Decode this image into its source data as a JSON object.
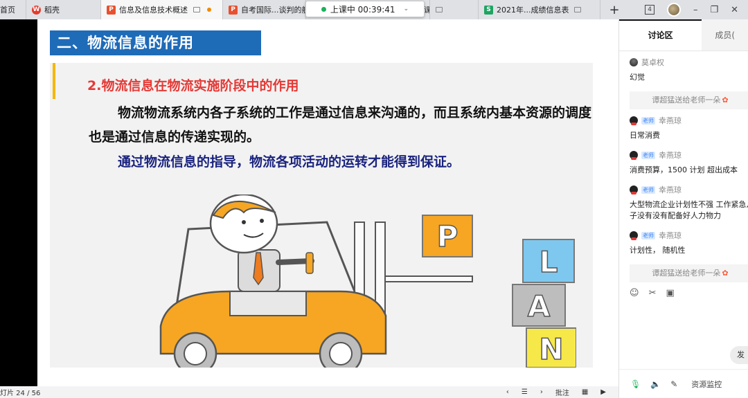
{
  "tabs": [
    {
      "label": "首页",
      "icon": "",
      "active": false
    },
    {
      "label": "稻壳",
      "icon": "wps-logo-icon",
      "active": false
    },
    {
      "label": "信息及信息技术概述",
      "icon": "presentation-file-icon",
      "active": true
    },
    {
      "label": "自考国际...谈判的舰",
      "icon": "presentation-file-icon",
      "active": false
    },
    {
      "label": "课件",
      "icon": "",
      "active": false
    },
    {
      "label": "2021年...成绩信息表",
      "icon": "spreadsheet-file-icon",
      "active": false
    }
  ],
  "tab_plus": "+",
  "window": {
    "badge": "4",
    "minimize": "–",
    "restore": "❐",
    "close": "✕"
  },
  "timer": {
    "text": "上课中 00:39:41",
    "status_color": "#19b35a"
  },
  "slide": {
    "title": "二、物流信息的作用",
    "subheading": "2.物流信息在物流实施阶段中的作用",
    "paragraph": "物流物流系统内各子系统的工作是通过信息来沟通的，而且系统内基本资源的调度也是通过信息的传递实现的。",
    "paragraph2": "通过物流信息的指导，物流各项活动的运转才能得到保证。",
    "plan_letters": [
      "P",
      "L",
      "A",
      "N"
    ],
    "colors": {
      "title_bg": "#1e6bb8",
      "subheading": "#e53935",
      "paragraph2": "#1a237e",
      "accent": "#f5b800"
    }
  },
  "panel": {
    "tabs": [
      "讨论区",
      "成员("
    ],
    "messages": [
      {
        "type": "msg",
        "name": "莫卓权",
        "teacher": false,
        "avatar": "photo",
        "text": "幻觉"
      },
      {
        "type": "gift",
        "text": "谭超猛送给老师一朵"
      },
      {
        "type": "msg",
        "name": "幸燕琼",
        "teacher": true,
        "avatar": "qq",
        "text": "日常消费"
      },
      {
        "type": "msg",
        "name": "幸燕琼",
        "teacher": true,
        "avatar": "qq",
        "text": "消费预算，1500  计划   超出成本"
      },
      {
        "type": "msg",
        "name": "幸燕琼",
        "teacher": true,
        "avatar": "qq",
        "text": "大型物流企业计划性不强   工作紧急,\n子没有没有配备好人力物力"
      },
      {
        "type": "msg",
        "name": "幸燕琼",
        "teacher": true,
        "avatar": "qq",
        "text": "计划性，   随机性"
      },
      {
        "type": "gift",
        "text": "谭超猛送给老师一朵"
      }
    ],
    "teacher_label": "老师",
    "send": "发",
    "footer_resource": "资源监控"
  },
  "status": {
    "page": "灯片 24 / 56",
    "annotate": "批注"
  }
}
